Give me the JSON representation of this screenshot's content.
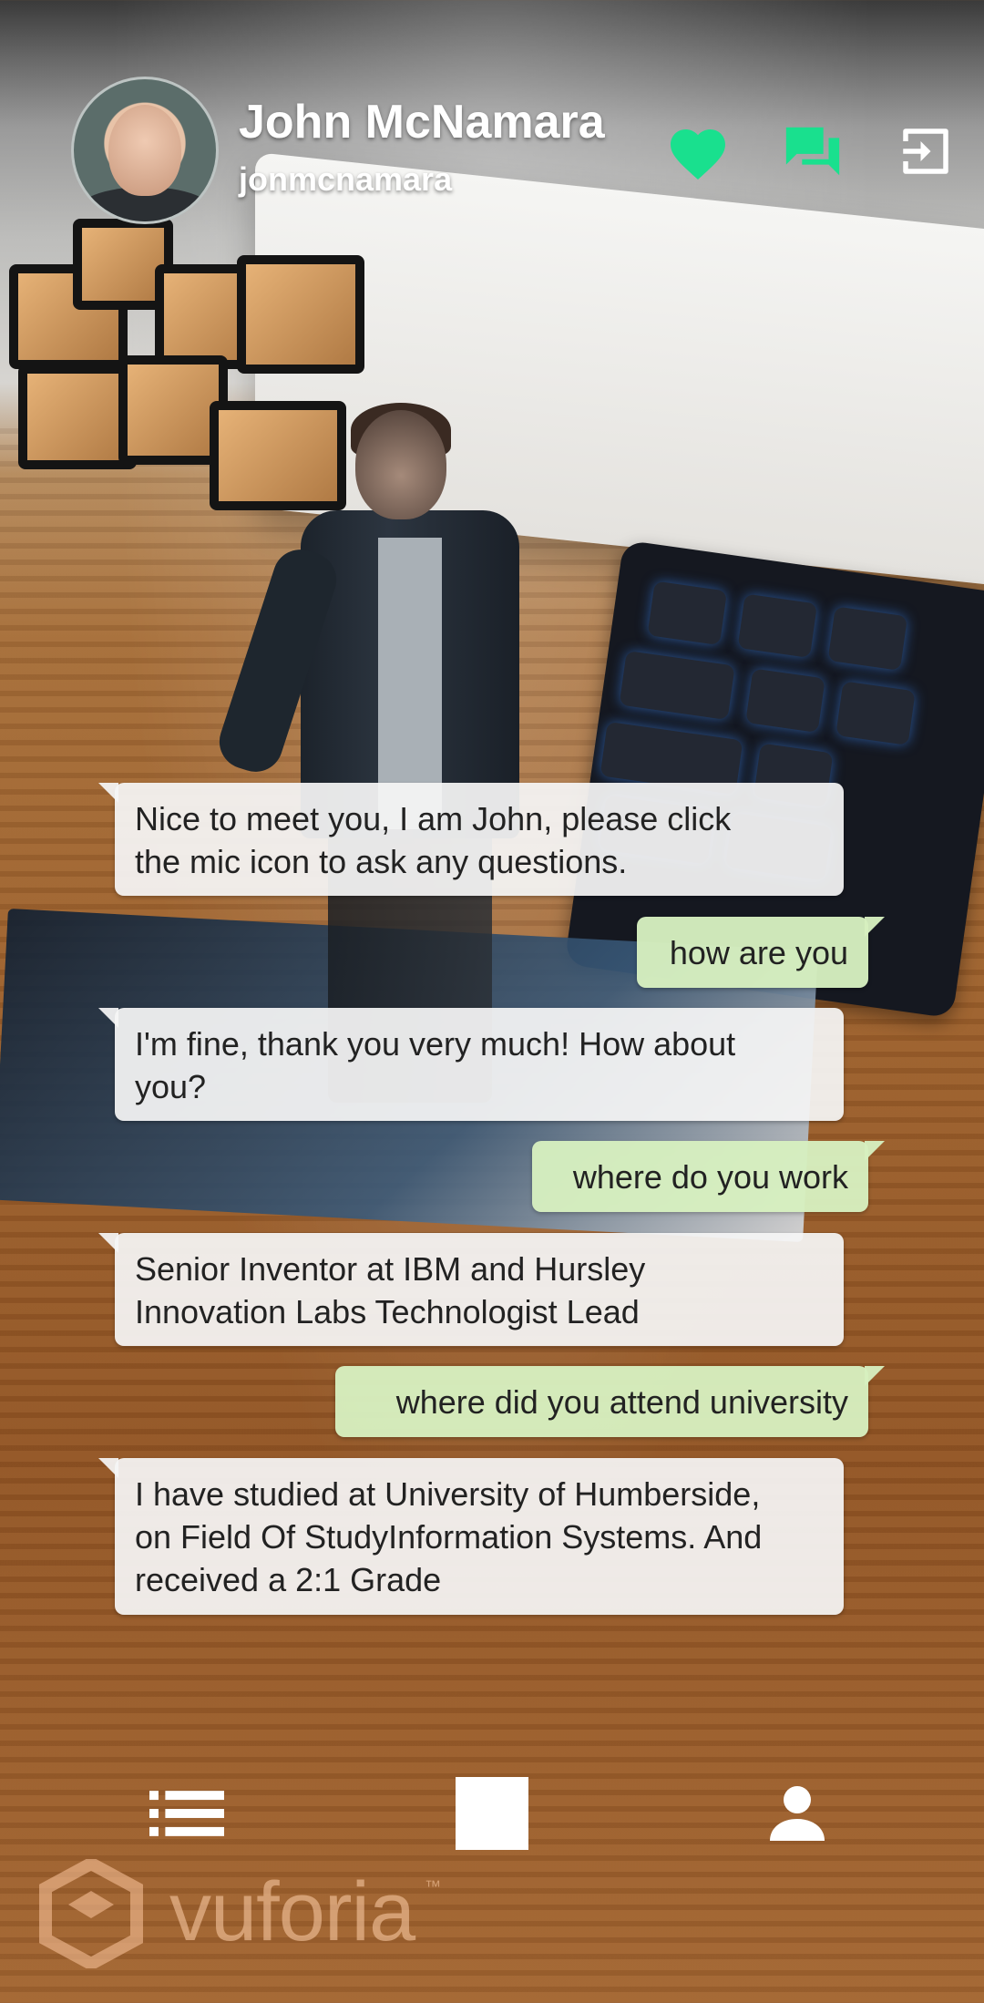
{
  "profile": {
    "name": "John McNamara",
    "username": "jonmcnamara"
  },
  "colors": {
    "accent": "#19e08e",
    "user_bubble": "#d6efc0",
    "bot_bubble": "#f5f5f5"
  },
  "header_icons": [
    "heart-icon",
    "chat-icon",
    "logout-icon"
  ],
  "messages": [
    {
      "from": "bot",
      "text": "Nice to meet you, I am John, please click\nthe mic icon to ask any questions."
    },
    {
      "from": "user",
      "text": "how are you"
    },
    {
      "from": "bot",
      "text": "I'm fine, thank you very much! How about\nyou?"
    },
    {
      "from": "user",
      "text": "where do you work"
    },
    {
      "from": "bot",
      "text": "Senior Inventor at IBM and Hursley\nInnovation Labs Technologist Lead"
    },
    {
      "from": "user",
      "text": "where did you attend university"
    },
    {
      "from": "bot",
      "text": "I have studied at University of Humberside,\non Field Of StudyInformation Systems. And\nreceived a 2:1 Grade"
    }
  ],
  "bottom_nav": [
    "list-icon",
    "stop-icon",
    "person-icon"
  ],
  "watermark": {
    "brand": "vuforia",
    "trademark": "™"
  }
}
